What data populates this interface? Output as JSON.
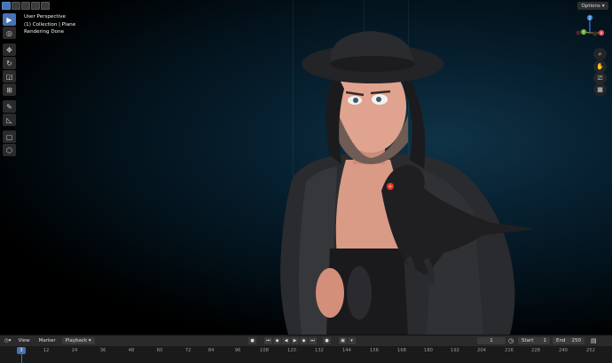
{
  "header": {
    "options_label": "Options"
  },
  "overlay": {
    "view_name": "User Perspective",
    "collection": "(1) Collection | Plane",
    "status": "Rendering Done"
  },
  "gizmo": {
    "z_label": "Z",
    "x_label": "X",
    "y_label": "Y"
  },
  "timeline": {
    "view": "View",
    "marker": "Marker",
    "playback": "Playback",
    "current_frame": "1",
    "start_label": "Start",
    "start": "1",
    "end_label": "End",
    "end": "250",
    "ticks": [
      "12",
      "24",
      "36",
      "48",
      "60",
      "72",
      "84",
      "96",
      "108",
      "120",
      "132",
      "144",
      "156",
      "168",
      "180",
      "192",
      "204",
      "216",
      "228",
      "240",
      "252"
    ],
    "playhead_frame": "3"
  },
  "colors": {
    "accent": "#4772b3",
    "axis_x": "#e04454",
    "axis_y": "#6ba33a",
    "axis_z": "#3b7fd6"
  }
}
